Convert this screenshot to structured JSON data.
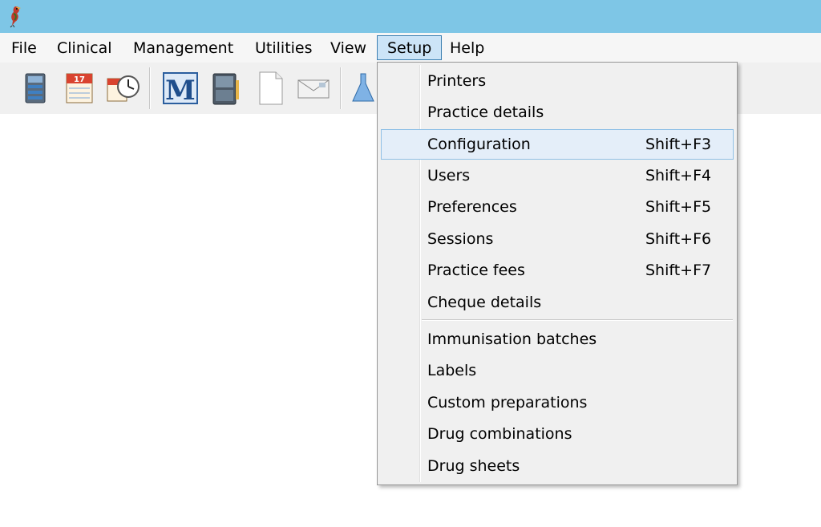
{
  "window": {
    "app_icon": "bird-logo-icon",
    "accent_color": "#7ec6e6"
  },
  "menubar": {
    "items": [
      {
        "label": "File"
      },
      {
        "label": "Clinical"
      },
      {
        "label": "Management"
      },
      {
        "label": "Utilities"
      },
      {
        "label": "View"
      },
      {
        "label": "Setup"
      },
      {
        "label": "Help"
      }
    ],
    "active": "Setup"
  },
  "toolbar": {
    "buttons": [
      {
        "icon": "server-icon"
      },
      {
        "icon": "calendar-icon",
        "text": "17"
      },
      {
        "icon": "appointment-clock-icon"
      },
      {
        "icon": "mims-m-icon",
        "text": "M"
      },
      {
        "icon": "filing-cabinet-icon"
      },
      {
        "icon": "blank-document-icon"
      },
      {
        "icon": "envelope-icon"
      },
      {
        "icon": "flask-icon"
      }
    ]
  },
  "setup_menu": {
    "items": [
      {
        "label": "Printers",
        "shortcut": ""
      },
      {
        "label": "Practice details",
        "shortcut": ""
      },
      {
        "label": "Configuration",
        "shortcut": "Shift+F3",
        "highlighted": true
      },
      {
        "label": "Users",
        "shortcut": "Shift+F4"
      },
      {
        "label": "Preferences",
        "shortcut": "Shift+F5"
      },
      {
        "label": "Sessions",
        "shortcut": "Shift+F6"
      },
      {
        "label": "Practice fees",
        "shortcut": "Shift+F7"
      },
      {
        "label": "Cheque details",
        "shortcut": ""
      },
      {
        "label": "Immunisation batches",
        "shortcut": ""
      },
      {
        "label": "Labels",
        "shortcut": ""
      },
      {
        "label": "Custom preparations",
        "shortcut": ""
      },
      {
        "label": "Drug combinations",
        "shortcut": ""
      },
      {
        "label": "Drug sheets",
        "shortcut": ""
      }
    ]
  }
}
